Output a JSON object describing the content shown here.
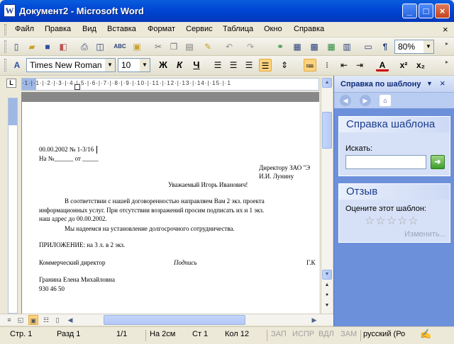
{
  "window": {
    "title": "Документ2 - Microsoft Word",
    "app_icon": "W"
  },
  "menu": [
    "Файл",
    "Правка",
    "Вид",
    "Вставка",
    "Формат",
    "Сервис",
    "Таблица",
    "Окно",
    "Справка"
  ],
  "toolbar": {
    "zoom": "80%",
    "style": "Times New Roman",
    "size": "10",
    "bold": "Ж",
    "italic": "К",
    "underline": "Ч",
    "font_color_glyph": "A",
    "superscript": "x²",
    "subscript": "x₂"
  },
  "document": {
    "lines": [
      "00.00.2002 № 1-3/16",
      "На №______ от _____",
      "Директору ЗАО \"Э",
      "И.И. Лунину",
      "Уважаемый  Игорь Иванович!",
      "В  соответствии  с  нашей  договоренностью  направляем  Вам  2  экз.  проекта",
      "информационных  услуг.  При отсутствии  возражений  просим  подписать  их  и 1  экз.",
      "наш адрес до 00.00.2002.",
      "Мы надеемся на установление долгосрочного сотрудничества.",
      "ПРИЛОЖЕНИЕ: на 3 л. в 2 экз.",
      "Коммерческий директор",
      "Подпись",
      "Г.К",
      "Гранина Елена Михайловна",
      "930 46 50"
    ]
  },
  "taskpane": {
    "title": "Справка по шаблону",
    "section1_title": "Справка шаблона",
    "search_label": "Искать:",
    "search_value": "",
    "section2_title": "Отзыв",
    "rate_label": "Оцените этот шаблон:",
    "stars": 0,
    "change_link": "Изменить..."
  },
  "statusbar": {
    "page": "Стр.  1",
    "section": "Разд  1",
    "pages": "1/1",
    "at": "На  2см",
    "line": "Ст  1",
    "col": "Кол  12",
    "rec": "ЗАП",
    "trk": "ИСПР",
    "ext": "ВДЛ",
    "ovr": "ЗАМ",
    "lang": "русский (Ро"
  }
}
